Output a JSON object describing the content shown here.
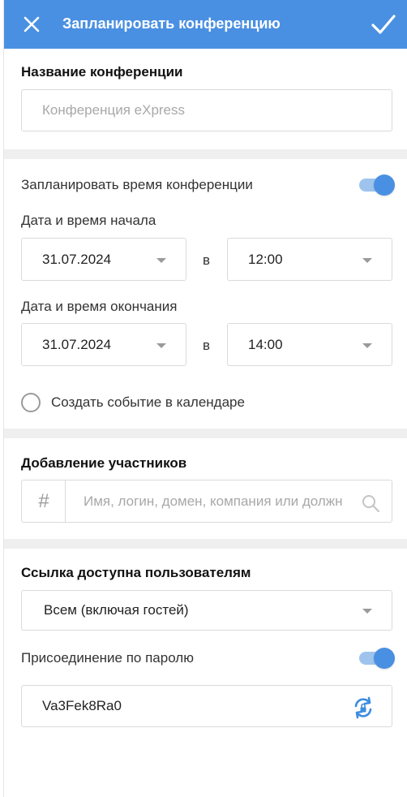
{
  "header": {
    "title": "Запланировать конференцию",
    "color": "#4a90e2"
  },
  "conference_name": {
    "label": "Название конференции",
    "placeholder": "Конференция eXpress"
  },
  "schedule": {
    "toggle_label": "Запланировать время конференции",
    "toggle_on": true,
    "start_label": "Дата и время начала",
    "start_date": "31.07.2024",
    "at_word": "в",
    "start_time": "12:00",
    "end_label": "Дата и время окончания",
    "end_date": "31.07.2024",
    "end_time": "14:00",
    "calendar_label": "Создать событие в календаре",
    "calendar_checked": false
  },
  "participants": {
    "label": "Добавление участников",
    "hash_symbol": "#",
    "placeholder": "Имя, логин, домен, компания или должн"
  },
  "link_access": {
    "label": "Ссылка доступна пользователям",
    "selected": "Всем (включая гостей)",
    "password_label": "Присоединение по паролю",
    "password_on": true,
    "password_value": "Va3Fek8Ra0"
  }
}
